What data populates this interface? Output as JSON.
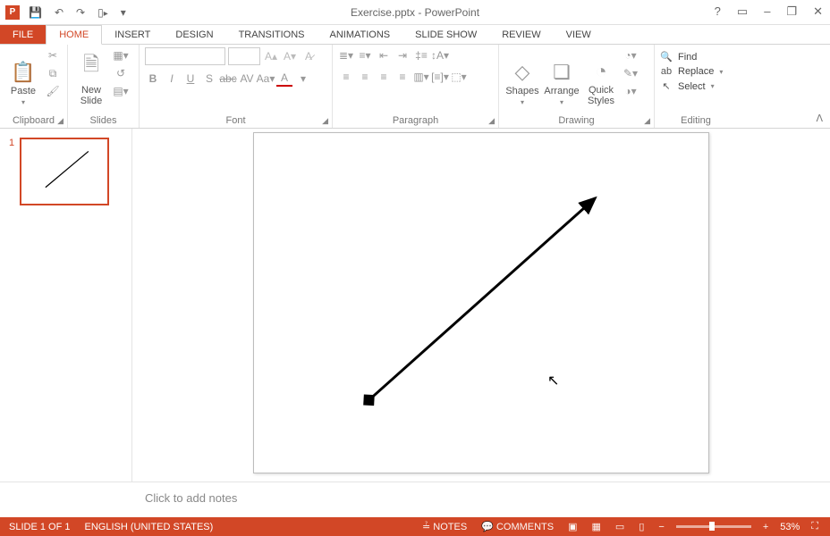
{
  "title": "Exercise.pptx - PowerPoint",
  "qat": {
    "save": "💾",
    "undo": "↶",
    "redo": "↷",
    "start": "▾"
  },
  "winControls": {
    "help": "?",
    "ribbonOpts": "▭",
    "minimize": "–",
    "restore": "❐",
    "close": "✕"
  },
  "tabs": {
    "file": "FILE",
    "items": [
      "HOME",
      "INSERT",
      "DESIGN",
      "TRANSITIONS",
      "ANIMATIONS",
      "SLIDE SHOW",
      "REVIEW",
      "VIEW"
    ],
    "activeIndex": 0
  },
  "ribbon": {
    "clipboard": {
      "label": "Clipboard",
      "paste": "Paste"
    },
    "slides": {
      "label": "Slides",
      "newSlide": "New\nSlide"
    },
    "font": {
      "label": "Font",
      "fontName": "",
      "fontSize": ""
    },
    "paragraph": {
      "label": "Paragraph"
    },
    "drawing": {
      "label": "Drawing",
      "shapes": "Shapes",
      "arrange": "Arrange",
      "quick": "Quick\nStyles"
    },
    "editing": {
      "label": "Editing",
      "find": "Find",
      "replace": "Replace",
      "select": "Select"
    }
  },
  "thumb": {
    "number": "1"
  },
  "notes": {
    "placeholder": "Click to add notes"
  },
  "status": {
    "slideInfo": "SLIDE 1 OF 1",
    "language": "ENGLISH (UNITED STATES)",
    "notes": "NOTES",
    "comments": "COMMENTS",
    "zoom": "53%"
  }
}
